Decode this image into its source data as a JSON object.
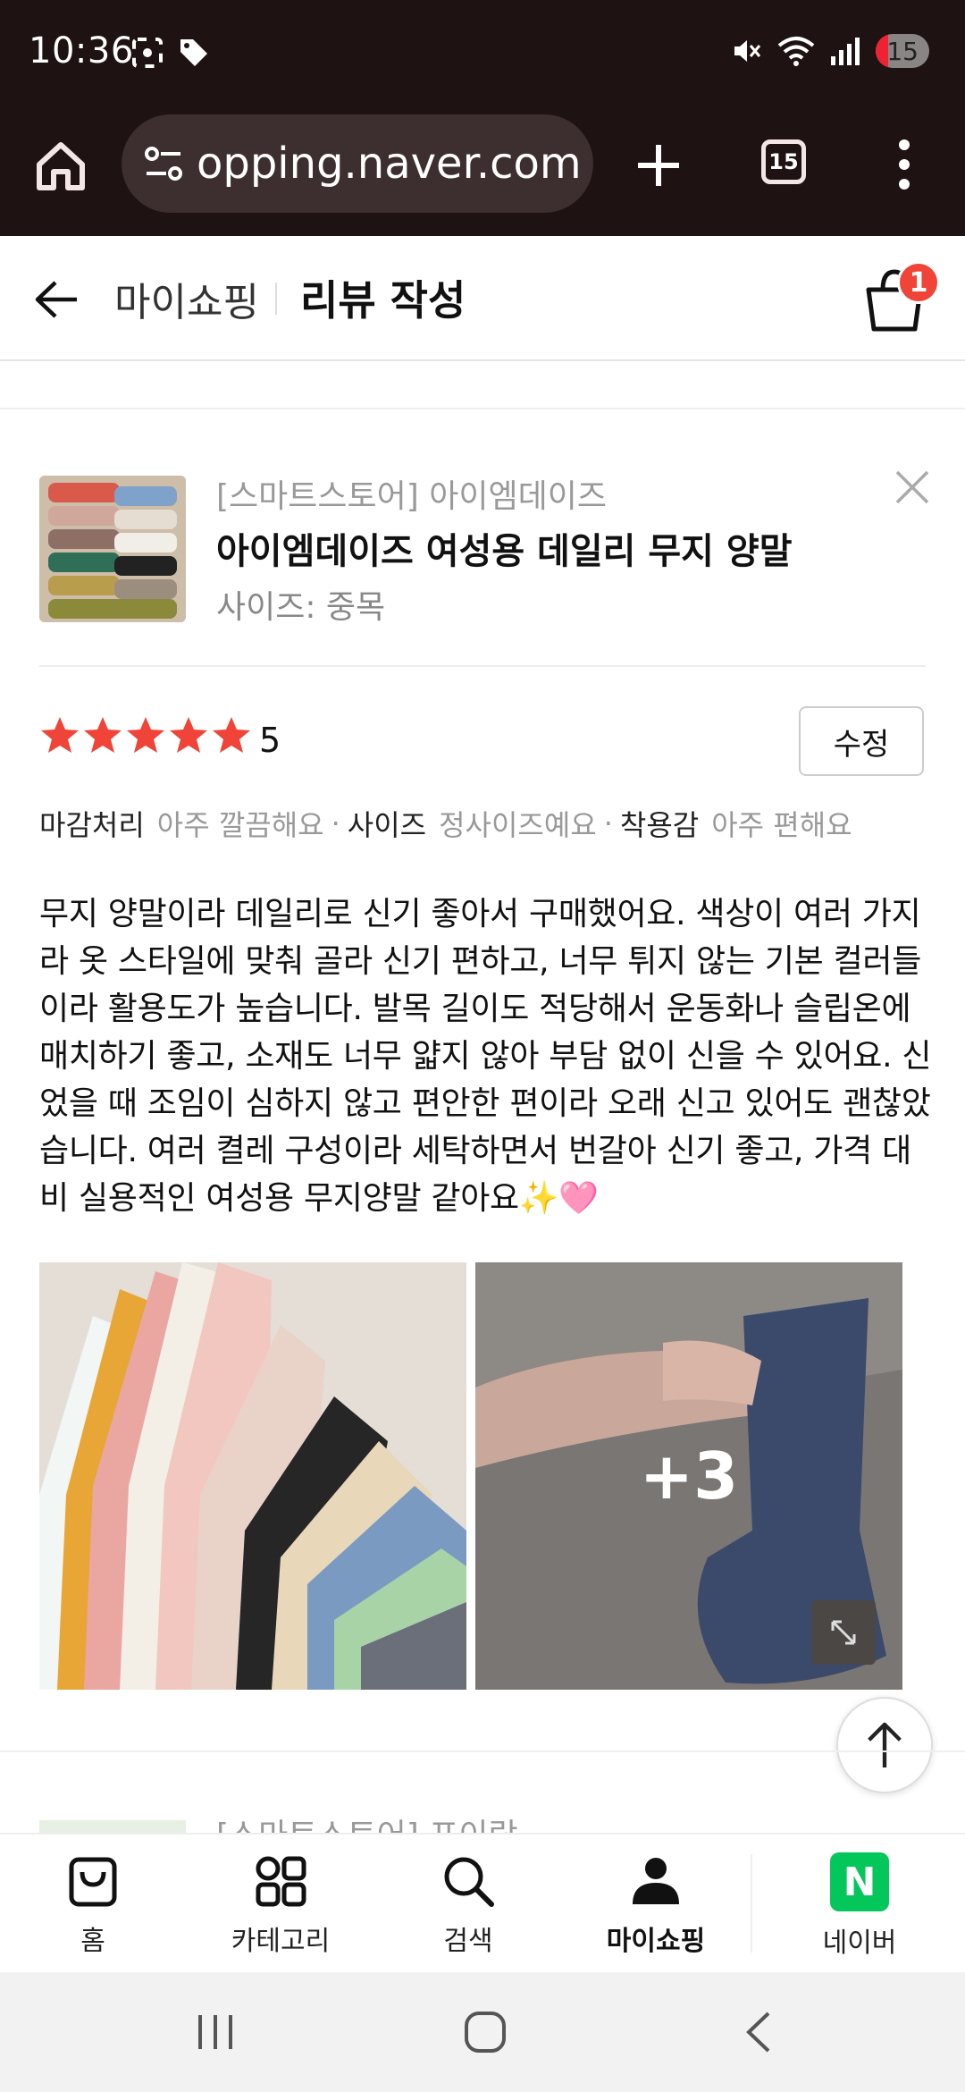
{
  "status_bar": {
    "time": "10:36",
    "battery": "15"
  },
  "browser": {
    "url": "opping.naver.com",
    "tab_count": "15"
  },
  "header": {
    "breadcrumb_prev": "마이쇼핑",
    "title": "리뷰 작성",
    "cart_count": "1"
  },
  "product": {
    "store": "[스마트스토어] 아이엠데이즈",
    "name": "아이엠데이즈 여성용 데일리 무지 양말",
    "option": "사이즈: 중목"
  },
  "rating": {
    "value": "5",
    "stars": 5,
    "star_color": "#f04438",
    "edit_label": "수정"
  },
  "tags": [
    {
      "key": "마감처리",
      "value": "아주 깔끔해요"
    },
    {
      "key": "사이즈",
      "value": "정사이즈예요"
    },
    {
      "key": "착용감",
      "value": "아주 편해요"
    }
  ],
  "review": {
    "text": "무지 양말이라 데일리로 신기 좋아서 구매했어요. 색상이 여러 가지라 옷 스타일에 맞춰 골라 신기 편하고, 너무 튀지 않는 기본 컬러들이라 활용도가 높습니다. 발목 길이도 적당해서 운동화나 슬립온에 매치하기 좋고, 소재도 너무 얇지 않아 부담 없이 신을 수 있어요. 신었을 때 조임이 심하지 않고 편안한 편이라 오래 신고 있어도 괜찮았습니다. 여러 켤레 구성이라 세탁하면서 번갈아 신기 좋고, 가격 대비 실용적인 여성용 무지양말 같아요✨🩷",
    "more_photos": "+3"
  },
  "next_item": {
    "store": "[스마트스토어] 포이랑"
  },
  "bottom_nav": {
    "items": [
      {
        "label": "홈",
        "icon": "bag-icon"
      },
      {
        "label": "카테고리",
        "icon": "grid-icon"
      },
      {
        "label": "검색",
        "icon": "search-icon"
      },
      {
        "label": "마이쇼핑",
        "icon": "person-icon",
        "active": true
      },
      {
        "label": "네이버",
        "icon": "naver-logo"
      }
    ],
    "naver_letter": "N"
  }
}
